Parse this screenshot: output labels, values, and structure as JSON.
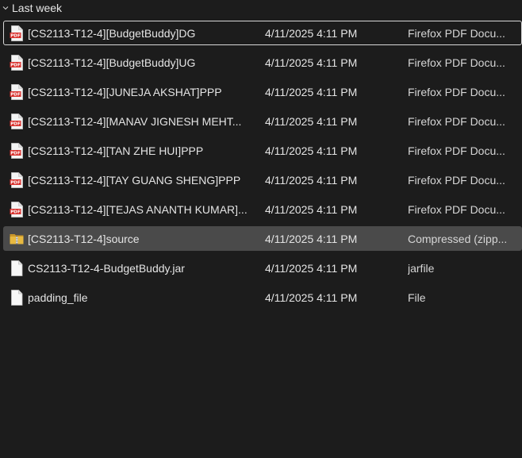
{
  "group": {
    "label": "Last week"
  },
  "files": [
    {
      "name": "[CS2113-T12-4][BudgetBuddy]DG",
      "date": "4/11/2025 4:11 PM",
      "type": "Firefox PDF Docu...",
      "icon": "pdf-file-icon"
    },
    {
      "name": "[CS2113-T12-4][BudgetBuddy]UG",
      "date": "4/11/2025 4:11 PM",
      "type": "Firefox PDF Docu...",
      "icon": "pdf-file-icon"
    },
    {
      "name": "[CS2113-T12-4][JUNEJA AKSHAT]PPP",
      "date": "4/11/2025 4:11 PM",
      "type": "Firefox PDF Docu...",
      "icon": "pdf-file-icon"
    },
    {
      "name": "[CS2113-T12-4][MANAV JIGNESH MEHT...",
      "date": "4/11/2025 4:11 PM",
      "type": "Firefox PDF Docu...",
      "icon": "pdf-file-icon"
    },
    {
      "name": "[CS2113-T12-4][TAN ZHE HUI]PPP",
      "date": "4/11/2025 4:11 PM",
      "type": "Firefox PDF Docu...",
      "icon": "pdf-file-icon"
    },
    {
      "name": "[CS2113-T12-4][TAY GUANG SHENG]PPP",
      "date": "4/11/2025 4:11 PM",
      "type": "Firefox PDF Docu...",
      "icon": "pdf-file-icon"
    },
    {
      "name": "[CS2113-T12-4][TEJAS ANANTH KUMAR]...",
      "date": "4/11/2025 4:11 PM",
      "type": "Firefox PDF Docu...",
      "icon": "pdf-file-icon"
    },
    {
      "name": "[CS2113-T12-4]source",
      "date": "4/11/2025 4:11 PM",
      "type": "Compressed (zipp...",
      "icon": "zip-folder-icon"
    },
    {
      "name": "CS2113-T12-4-BudgetBuddy.jar",
      "date": "4/11/2025 4:11 PM",
      "type": "jarfile",
      "icon": "blank-file-icon"
    },
    {
      "name": "padding_file",
      "date": "4/11/2025 4:11 PM",
      "type": "File",
      "icon": "blank-file-icon"
    }
  ],
  "colors": {
    "background": "#1c1c1c",
    "selected_row": "#4a4a4a",
    "focus_border": "#d8d8d8",
    "pdf_red": "#d9302c",
    "zip_yellow": "#e8b940"
  }
}
